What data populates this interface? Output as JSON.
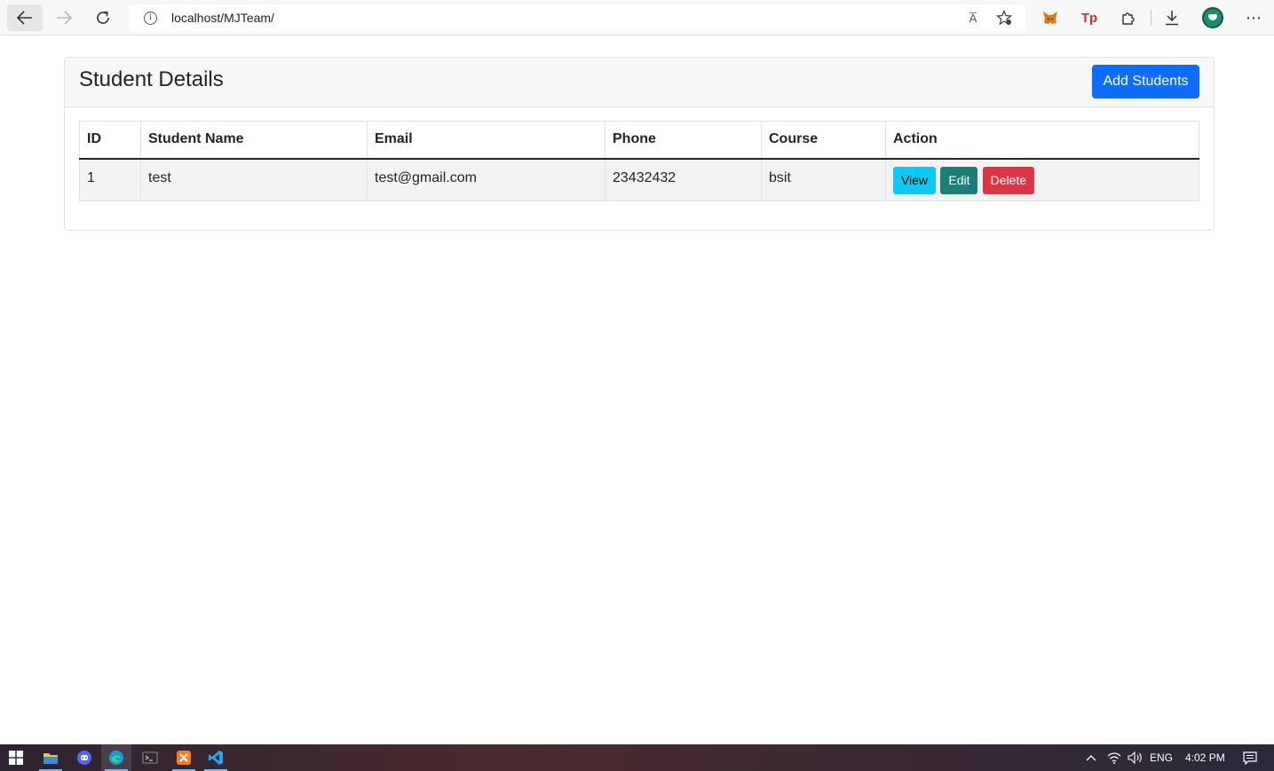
{
  "browser": {
    "url": "localhost/MJTeam/",
    "read_aloud_label": "A̅",
    "icons": [
      "back-arrow-icon",
      "forward-arrow-icon",
      "refresh-icon",
      "info-icon",
      "read-aloud-icon",
      "favorite-star-icon",
      "metamask-extension-icon",
      "tp-extension-icon",
      "extensions-puzzle-icon",
      "download-icon",
      "profile-avatar-icon",
      "more-menu-icon"
    ],
    "tp_label": "Tp",
    "more_label": "⋯"
  },
  "card": {
    "title": "Student Details",
    "add_button_label": "Add Students"
  },
  "table": {
    "headers": {
      "id": "ID",
      "name": "Student Name",
      "email": "Email",
      "phone": "Phone",
      "course": "Course",
      "action": "Action"
    },
    "rows": [
      {
        "id": "1",
        "name": "test",
        "email": "test@gmail.com",
        "phone": "23432432",
        "course": "bsit",
        "actions": {
          "view": "View",
          "edit": "Edit",
          "delete": "Delete"
        }
      }
    ]
  },
  "colors": {
    "primary": "#0d6efd",
    "view": "#0dcaf0",
    "edit": "#1c7f76",
    "delete": "#dc3545"
  },
  "taskbar": {
    "language": "ENG",
    "time": "4:02 PM"
  }
}
